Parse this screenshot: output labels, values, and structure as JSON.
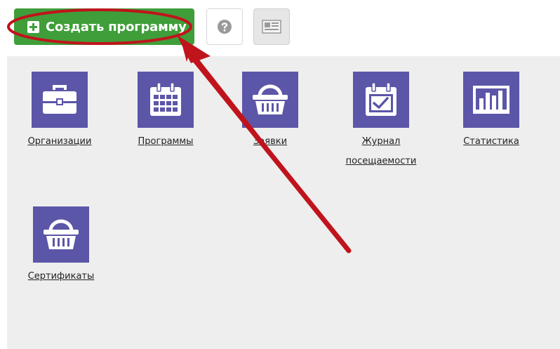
{
  "toolbar": {
    "create_label": "Создать программу",
    "create_icon": "plus-square-icon",
    "help_icon": "question-circle-icon",
    "news_icon": "newspaper-icon"
  },
  "tiles": [
    {
      "label": "Организации",
      "icon": "briefcase-icon"
    },
    {
      "label": "Программы",
      "icon": "calendar-icon"
    },
    {
      "label": "Заявки",
      "icon": "basket-icon"
    },
    {
      "label": "Журнал посещаемости",
      "icon": "calendar-check-icon"
    },
    {
      "label": "Статистика",
      "icon": "bar-chart-icon"
    },
    {
      "label": "Сертификаты",
      "icon": "basket-icon"
    }
  ],
  "colors": {
    "create_button": "#3f9e3a",
    "tile_icon_bg": "#5b56a8",
    "panel_bg": "#eeeeee",
    "annotation": "#c0141c"
  }
}
